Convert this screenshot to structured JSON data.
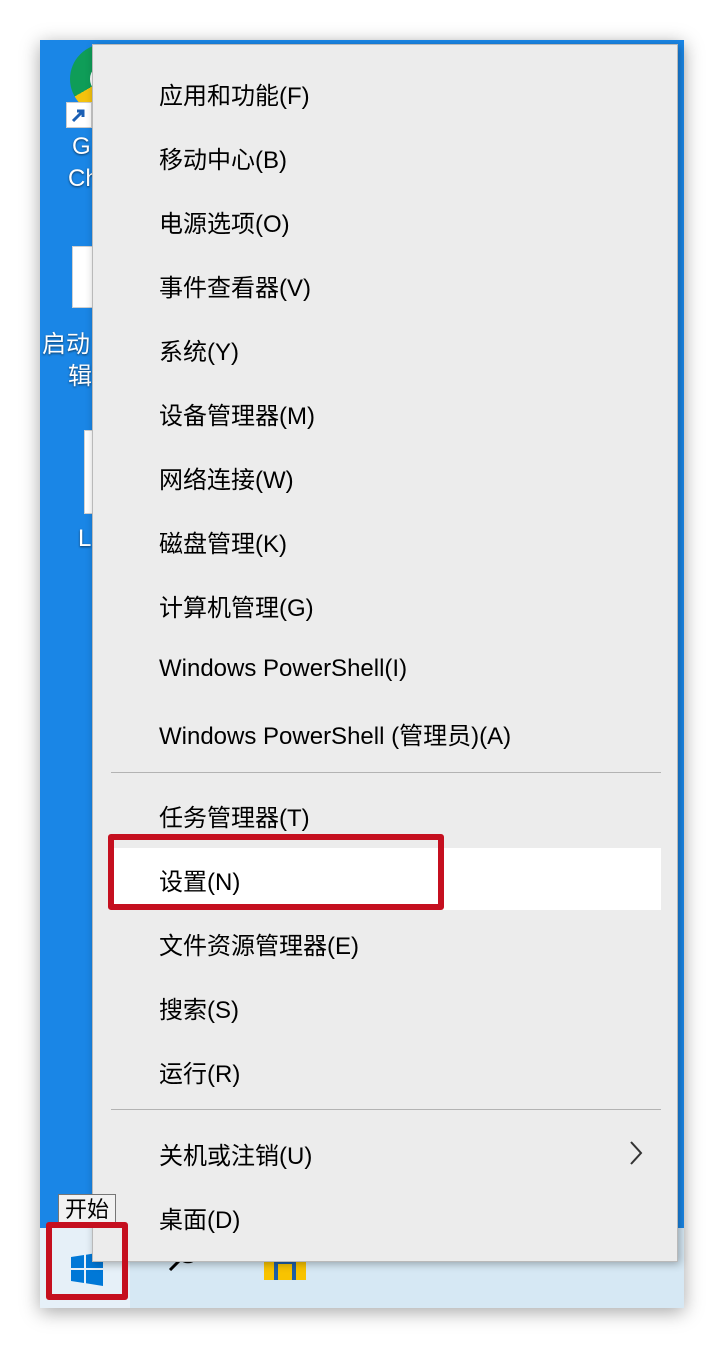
{
  "desktop": {
    "icons": [
      {
        "label_lines": [
          "G",
          "Ch"
        ]
      },
      {
        "label_lines": [
          "启动",
          "辑"
        ]
      },
      {
        "label_lines": [
          "L"
        ]
      }
    ]
  },
  "menu": {
    "items": [
      {
        "label": "应用和功能(F)"
      },
      {
        "label": "移动中心(B)"
      },
      {
        "label": "电源选项(O)"
      },
      {
        "label": "事件查看器(V)"
      },
      {
        "label": "系统(Y)"
      },
      {
        "label": "设备管理器(M)"
      },
      {
        "label": "网络连接(W)"
      },
      {
        "label": "磁盘管理(K)"
      },
      {
        "label": "计算机管理(G)"
      },
      {
        "label": "Windows PowerShell(I)"
      },
      {
        "label": "Windows PowerShell (管理员)(A)"
      },
      {
        "label": "任务管理器(T)"
      },
      {
        "label": "设置(N)"
      },
      {
        "label": "文件资源管理器(E)"
      },
      {
        "label": "搜索(S)"
      },
      {
        "label": "运行(R)"
      },
      {
        "label": "关机或注销(U)"
      },
      {
        "label": "桌面(D)"
      }
    ],
    "highlighted_item": "设置(N)",
    "submenu_item": "关机或注销(U)"
  },
  "taskbar": {
    "start_tooltip": "开始",
    "icons": [
      "windows-logo-icon",
      "search-icon",
      "file-explorer-icon"
    ]
  },
  "colors": {
    "desktop": "#1a86e6",
    "menu_bg": "#ececec",
    "highlight_bg": "#ffffff",
    "annotation_red": "#c50f1f",
    "taskbar": "#d6e8f4"
  }
}
